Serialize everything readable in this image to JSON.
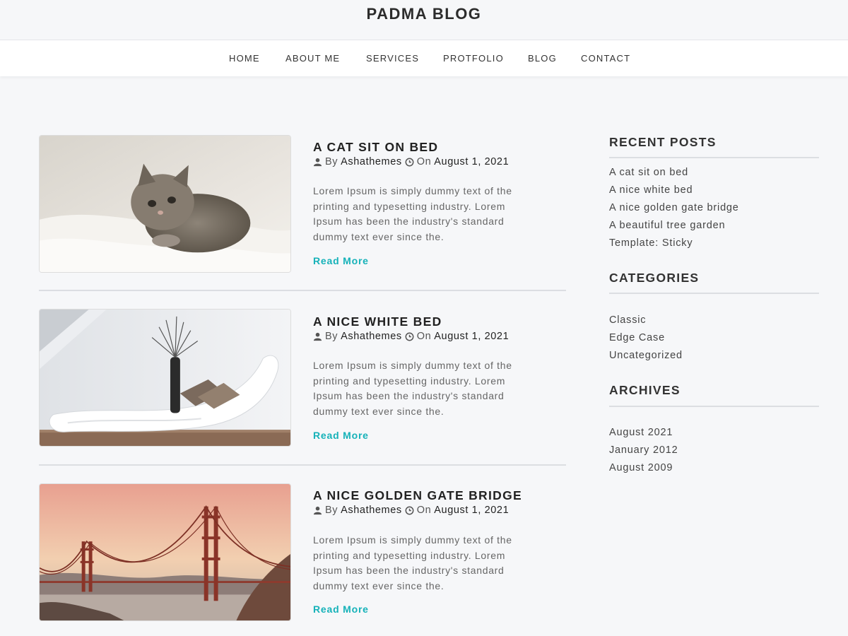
{
  "site": {
    "title": "PADMA BLOG"
  },
  "nav": [
    {
      "label": "HOME"
    },
    {
      "label": "ABOUT ME"
    },
    {
      "label": "SERVICES"
    },
    {
      "label": "PROTFOLIO"
    },
    {
      "label": "BLOG"
    },
    {
      "label": "CONTACT"
    }
  ],
  "posts": [
    {
      "title": "A CAT SIT ON BED",
      "by_label": "By",
      "author": "Ashathemes",
      "on_label": "On",
      "date": "August 1, 2021",
      "excerpt": "Lorem Ipsum is simply dummy text of the printing and typesetting industry. Lorem Ipsum has been the industry's standard dummy text ever since the.",
      "read_more": "Read More",
      "image": "kitten-on-bed"
    },
    {
      "title": "A NICE WHITE BED",
      "by_label": "By",
      "author": "Ashathemes",
      "on_label": "On",
      "date": "August 1, 2021",
      "excerpt": "Lorem Ipsum is simply dummy text of the printing and typesetting industry. Lorem Ipsum has been the industry's standard dummy text ever since the.",
      "read_more": "Read More",
      "image": "white-chaise-lounge"
    },
    {
      "title": "A NICE GOLDEN GATE BRIDGE",
      "by_label": "By",
      "author": "Ashathemes",
      "on_label": "On",
      "date": "August 1, 2021",
      "excerpt": "Lorem Ipsum is simply dummy text of the printing and typesetting industry. Lorem Ipsum has been the industry's standard dummy text ever since the.",
      "read_more": "Read More",
      "image": "golden-gate-bridge"
    }
  ],
  "sidebar": {
    "recent": {
      "title": "RECENT POSTS",
      "items": [
        "A cat sit on bed",
        "A nice white bed",
        "A nice golden gate bridge",
        "A beautiful tree garden",
        "Template: Sticky"
      ]
    },
    "categories": {
      "title": "CATEGORIES",
      "items": [
        "Classic",
        "Edge Case",
        "Uncategorized"
      ]
    },
    "archives": {
      "title": "ARCHIVES",
      "items": [
        "August 2021",
        "January 2012",
        "August 2009"
      ]
    }
  },
  "icons": {
    "author": "user-icon",
    "date": "clock-icon"
  },
  "colors": {
    "accent": "#16b2b9",
    "background": "#f6f7f9",
    "heading": "#222222"
  }
}
